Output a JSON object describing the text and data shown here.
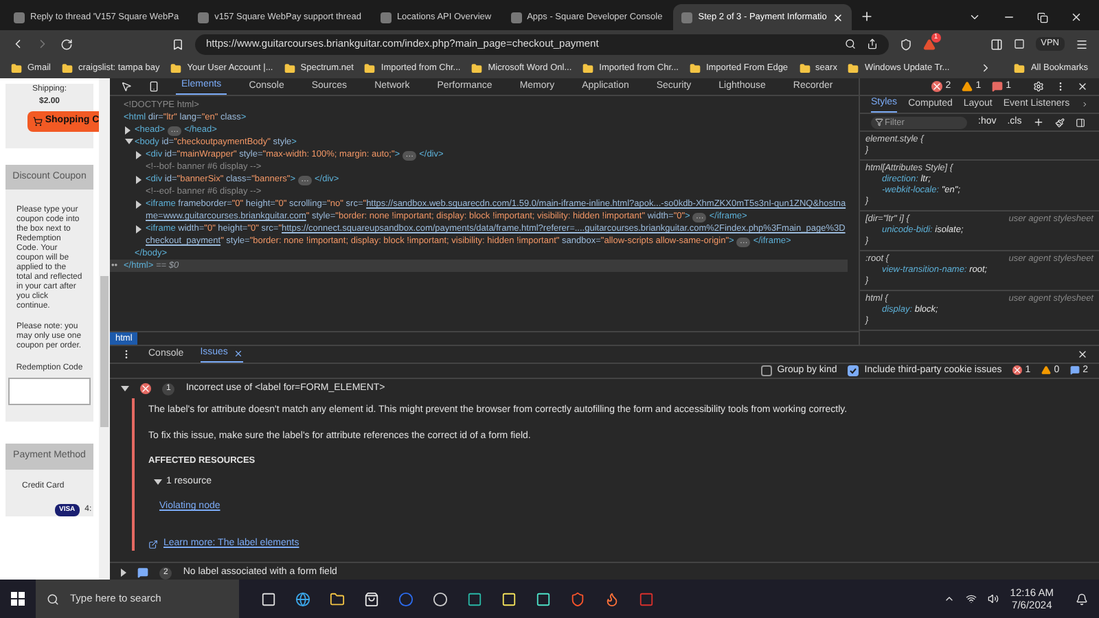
{
  "browser_tabs": [
    {
      "title": "Reply to thread 'V157 Square WebPa",
      "selected": false
    },
    {
      "title": "v157 Square WebPay support thread",
      "selected": false
    },
    {
      "title": "Locations API Overview",
      "selected": false
    },
    {
      "title": "Apps - Square Developer Console",
      "selected": false
    },
    {
      "title": "Step 2 of 3 - Payment Informatio",
      "selected": true
    }
  ],
  "address_bar": {
    "url": "https://www.guitarcourses.briankguitar.com/index.php?main_page=checkout_payment",
    "notification_count": "1",
    "vpn": "VPN"
  },
  "bookmarks": [
    {
      "label": "Gmail"
    },
    {
      "label": "craigslist: tampa bay"
    },
    {
      "label": "Your User Account |..."
    },
    {
      "label": "Spectrum.net"
    },
    {
      "label": "Imported from Chr..."
    },
    {
      "label": "Microsoft Word Onl..."
    },
    {
      "label": "Imported from Chr..."
    },
    {
      "label": "Imported From Edge"
    },
    {
      "label": "searx"
    },
    {
      "label": "Windows Update Tr..."
    }
  ],
  "all_bookmarks": "All Bookmarks",
  "page": {
    "shipping_label": "Shipping:",
    "shipping_value": "$2.00",
    "cart_button": "Shopping C",
    "coupon_heading": "Discount Coupon",
    "coupon_paragraphs": [
      "Please type your coupon code into the box next to Redemption Code. Your coupon will be applied to the total and reflected in your cart after you click continue.",
      "Please note: you may only use one coupon per order."
    ],
    "redemption_label": "Redemption Code",
    "payment_heading": "Payment Method",
    "payment_option": "Credit Card",
    "card_logo": "VISA",
    "card_number": "4:"
  },
  "devtools": {
    "tabs": [
      {
        "label": "Elements",
        "selected": true
      },
      {
        "label": "Console",
        "selected": false
      },
      {
        "label": "Sources",
        "selected": false
      },
      {
        "label": "Network",
        "selected": false
      },
      {
        "label": "Performance",
        "selected": false
      },
      {
        "label": "Memory",
        "selected": false
      },
      {
        "label": "Application",
        "selected": false
      },
      {
        "label": "Security",
        "selected": false
      },
      {
        "label": "Lighthouse",
        "selected": false
      },
      {
        "label": "Recorder",
        "selected": false
      }
    ],
    "counters": [
      {
        "kind": "error",
        "count": "2"
      },
      {
        "kind": "warning",
        "count": "1"
      },
      {
        "kind": "issue",
        "count": "1"
      }
    ],
    "dom": [
      {
        "line": [
          {
            "kind": "comment",
            "text": "<!DOCTYPE html>"
          }
        ]
      },
      {
        "line": [
          {
            "kind": "tag",
            "text": "<html"
          },
          {
            "kind": "attr",
            "text": " dir="
          },
          {
            "kind": "value",
            "text": "\"ltr\""
          },
          {
            "kind": "attr",
            "text": " lang="
          },
          {
            "kind": "value",
            "text": "\"en\""
          },
          {
            "kind": "attr",
            "text": " class"
          },
          {
            "kind": "tag",
            "text": ">"
          }
        ],
        "selected": true,
        "gutter": "••",
        "children": [
          {
            "expanded": false,
            "line": [
              {
                "kind": "tag",
                "text": "<head>"
              },
              {
                "kind": "ellipsis",
                "text": "…"
              },
              {
                "kind": "tag",
                "text": "</head>"
              }
            ]
          },
          {
            "expanded": true,
            "line": [
              {
                "kind": "tag",
                "text": "<body"
              },
              {
                "kind": "attr",
                "text": " id="
              },
              {
                "kind": "value",
                "text": "\"checkoutpaymentBody\""
              },
              {
                "kind": "attr",
                "text": " style"
              },
              {
                "kind": "tag",
                "text": ">"
              }
            ],
            "children": [
              {
                "expanded": false,
                "line": [
                  {
                    "kind": "tag",
                    "text": "<div"
                  },
                  {
                    "kind": "attr",
                    "text": " id="
                  },
                  {
                    "kind": "value",
                    "text": "\"mainWrapper\""
                  },
                  {
                    "kind": "attr",
                    "text": " style="
                  },
                  {
                    "kind": "value",
                    "text": "\"max-width: 100%; margin: auto;\""
                  },
                  {
                    "kind": "tag",
                    "text": ">"
                  },
                  {
                    "kind": "ellipsis",
                    "text": "…"
                  },
                  {
                    "kind": "tag",
                    "text": "</div>"
                  }
                ]
              },
              {
                "line": [
                  {
                    "kind": "comment",
                    "text": "<!--bof- banner #6 display -->"
                  }
                ]
              },
              {
                "expanded": false,
                "line": [
                  {
                    "kind": "tag",
                    "text": "<div"
                  },
                  {
                    "kind": "attr",
                    "text": " id="
                  },
                  {
                    "kind": "value",
                    "text": "\"bannerSix\""
                  },
                  {
                    "kind": "attr",
                    "text": " class="
                  },
                  {
                    "kind": "value",
                    "text": "\"banners\""
                  },
                  {
                    "kind": "tag",
                    "text": ">"
                  },
                  {
                    "kind": "ellipsis",
                    "text": "…"
                  },
                  {
                    "kind": "tag",
                    "text": "</div>"
                  }
                ]
              },
              {
                "line": [
                  {
                    "kind": "comment",
                    "text": "<!--eof- banner #6 display -->"
                  }
                ]
              },
              {
                "expanded": false,
                "line": [
                  {
                    "kind": "tag",
                    "text": "<iframe"
                  },
                  {
                    "kind": "attr",
                    "text": " frameborder="
                  },
                  {
                    "kind": "value",
                    "text": "\"0\""
                  },
                  {
                    "kind": "attr",
                    "text": " height="
                  },
                  {
                    "kind": "value",
                    "text": "\"0\""
                  },
                  {
                    "kind": "attr",
                    "text": " scrolling="
                  },
                  {
                    "kind": "value",
                    "text": "\"no\""
                  },
                  {
                    "kind": "attr",
                    "text": " src="
                  },
                  {
                    "kind": "value",
                    "text": "\""
                  },
                  {
                    "kind": "link",
                    "text": "https://sandbox.web.squarecdn.com/1.59.0/main-iframe-inline.html?apok...-so0kdb-XhmZKX0mT5s3nI-qun1ZNQ&hostname=www.guitarcourses.briankguitar.com"
                  },
                  {
                    "kind": "value",
                    "text": "\""
                  },
                  {
                    "kind": "attr",
                    "text": " style="
                  },
                  {
                    "kind": "value",
                    "text": "\"border: none !important; display: block !important; visibility: hidden !important\""
                  },
                  {
                    "kind": "attr",
                    "text": " width="
                  },
                  {
                    "kind": "value",
                    "text": "\"0\""
                  },
                  {
                    "kind": "tag",
                    "text": ">"
                  },
                  {
                    "kind": "ellipsis",
                    "text": "…"
                  },
                  {
                    "kind": "tag",
                    "text": "</iframe>"
                  }
                ]
              },
              {
                "expanded": false,
                "line": [
                  {
                    "kind": "tag",
                    "text": "<iframe"
                  },
                  {
                    "kind": "attr",
                    "text": " width="
                  },
                  {
                    "kind": "value",
                    "text": "\"0\""
                  },
                  {
                    "kind": "attr",
                    "text": " height="
                  },
                  {
                    "kind": "value",
                    "text": "\"0\""
                  },
                  {
                    "kind": "attr",
                    "text": " src="
                  },
                  {
                    "kind": "value",
                    "text": "\""
                  },
                  {
                    "kind": "link",
                    "text": "https://connect.squareupsandbox.com/payments/data/frame.html?referer=....guitarcourses.briankguitar.com%2Findex.php%3Fmain_page%3Dcheckout_payment"
                  },
                  {
                    "kind": "value",
                    "text": "\""
                  },
                  {
                    "kind": "attr",
                    "text": " style="
                  },
                  {
                    "kind": "value",
                    "text": "\"border: none !important; display: block !important; visibility: hidden !important\""
                  },
                  {
                    "kind": "attr",
                    "text": " sandbox="
                  },
                  {
                    "kind": "value",
                    "text": "\"allow-scripts allow-same-origin\""
                  },
                  {
                    "kind": "tag",
                    "text": ">"
                  },
                  {
                    "kind": "ellipsis",
                    "text": "…"
                  },
                  {
                    "kind": "tag",
                    "text": "</iframe>"
                  }
                ]
              }
            ],
            "end": [
              {
                "kind": "tag",
                "text": "</body>"
              }
            ]
          }
        ],
        "end": [
          {
            "kind": "tag",
            "text": "</html>"
          },
          {
            "kind": "hint",
            "text": " == $0"
          }
        ]
      }
    ],
    "breadcrumb": "html",
    "styles": {
      "tabs": [
        {
          "label": "Styles",
          "selected": true
        },
        {
          "label": "Computed",
          "selected": false
        },
        {
          "label": "Layout",
          "selected": false
        },
        {
          "label": "Event Listeners",
          "selected": false
        }
      ],
      "filter_placeholder": "Filter",
      "hov": ":hov",
      "cls": ".cls",
      "rules": [
        {
          "selector": "element.style {",
          "close": "}"
        },
        {
          "selector": "html[Attributes Style] {",
          "properties": [
            {
              "name": "direction:",
              "value": "ltr;"
            },
            {
              "name": "-webkit-locale:",
              "value": "\"en\";"
            }
          ],
          "close": "}"
        },
        {
          "selector": "[dir=\"ltr\" i] {",
          "source": "user agent stylesheet",
          "properties": [
            {
              "name": "unicode-bidi:",
              "value": "isolate;"
            }
          ],
          "close": "}"
        },
        {
          "selector": ":root {",
          "source": "user agent stylesheet",
          "properties": [
            {
              "name": "view-transition-name:",
              "value": "root;"
            }
          ],
          "close": "}"
        },
        {
          "selector": "html {",
          "source": "user agent stylesheet",
          "properties": [
            {
              "name": "display:",
              "value": "block;"
            }
          ],
          "close": "}"
        }
      ]
    }
  },
  "drawer": {
    "tabs": [
      {
        "label": "Console",
        "selected": false,
        "closable": false
      },
      {
        "label": "Issues",
        "selected": true,
        "closable": true
      }
    ],
    "group_by_kind": {
      "label": "Group by kind",
      "checked": false
    },
    "third_party": {
      "label": "Include third-party cookie issues",
      "checked": true
    },
    "counts": [
      {
        "kind": "error",
        "count": "1"
      },
      {
        "kind": "warning",
        "count": "0"
      },
      {
        "kind": "info",
        "count": "2"
      }
    ],
    "issues": [
      {
        "kind": "error",
        "count": "1",
        "title": "Incorrect use of <label for=FORM_ELEMENT>",
        "expanded": true,
        "description": [
          "The label's for attribute doesn't match any element id. This might prevent the browser from correctly autofilling the form and accessibility tools from working correctly.",
          "To fix this issue, make sure the label's for attribute references the correct id of a form field."
        ],
        "resources_heading": "AFFECTED RESOURCES",
        "resources_toggle": "1 resource",
        "resource_link": "Violating node",
        "learn_more": "Learn more: The label elements"
      },
      {
        "kind": "info",
        "count": "2",
        "title": "No label associated with a form field",
        "expanded": false
      }
    ]
  },
  "taskbar": {
    "search_placeholder": "Type here to search",
    "time": "12:16 AM",
    "date": "7/6/2024"
  }
}
